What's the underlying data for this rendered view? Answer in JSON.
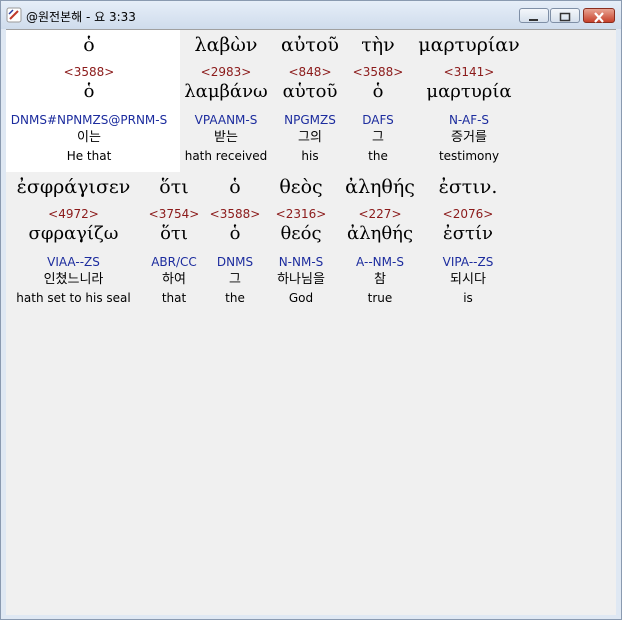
{
  "window": {
    "title": "@원전본해 - 요 3:33",
    "controls": {
      "minimize": "minimize",
      "maximize": "maximize",
      "close": "close"
    }
  },
  "words": [
    [
      {
        "greek": "ὁ",
        "strong": "<3588>",
        "lemma": "ὁ",
        "morph": "DNMS#NPNMZS@PRNM-S",
        "korean": "이는",
        "english": "He that"
      },
      {
        "greek": "λαβὼν",
        "strong": "<2983>",
        "lemma": "λαμβάνω",
        "morph": "VPAANM-S",
        "korean": "받는",
        "english": "hath received"
      },
      {
        "greek": "αὐτοῦ",
        "strong": "<848>",
        "lemma": "αὑτοῦ",
        "morph": "NPGMZS",
        "korean": "그의",
        "english": "his"
      },
      {
        "greek": "τὴν",
        "strong": "<3588>",
        "lemma": "ὁ",
        "morph": "DAFS",
        "korean": "그",
        "english": "the"
      },
      {
        "greek": "μαρτυρίαν",
        "strong": "<3141>",
        "lemma": "μαρτυρία",
        "morph": "N-AF-S",
        "korean": "증거를",
        "english": "testimony"
      }
    ],
    [
      {
        "greek": "ἐσφράγισεν",
        "strong": "<4972>",
        "lemma": "σφραγίζω",
        "morph": "VIAA--ZS",
        "korean": "인쳤느니라",
        "english": "hath set to his seal"
      },
      {
        "greek": "ὅτι",
        "strong": "<3754>",
        "lemma": "ὅτι",
        "morph": "ABR/CC",
        "korean": "하여",
        "english": "that"
      },
      {
        "greek": "ὁ",
        "strong": "<3588>",
        "lemma": "ὁ",
        "morph": "DNMS",
        "korean": "그",
        "english": "the"
      },
      {
        "greek": "θεὸς",
        "strong": "<2316>",
        "lemma": "θεός",
        "morph": "N-NM-S",
        "korean": "하나님을",
        "english": "God"
      },
      {
        "greek": "ἀληθής",
        "strong": "<227>",
        "lemma": "ἀληθής",
        "morph": "A--NM-S",
        "korean": "참",
        "english": "true"
      },
      {
        "greek": "ἐστιν.",
        "strong": "<2076>",
        "lemma": "ἐστίν",
        "morph": "VIPA--ZS",
        "korean": "되시다",
        "english": "is"
      }
    ]
  ]
}
